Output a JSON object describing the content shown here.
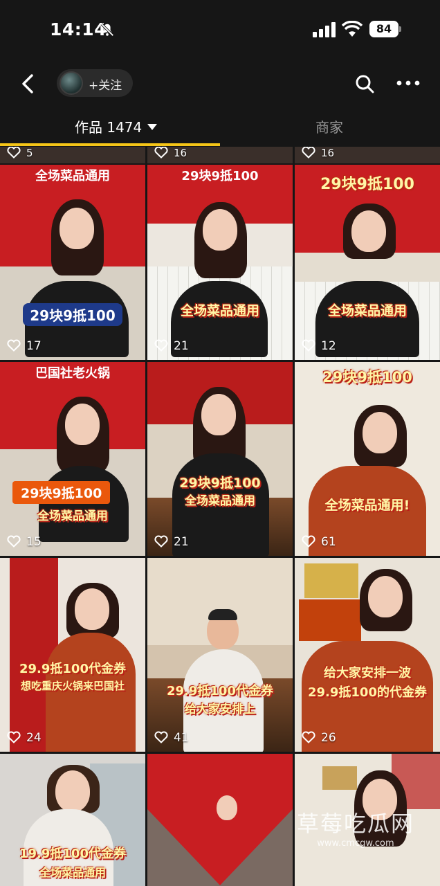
{
  "status_bar": {
    "time": "14:14",
    "battery": "84"
  },
  "nav": {
    "follow_label": "+关注"
  },
  "tabs": {
    "works_label": "作品 1474",
    "merchant_label": "商家"
  },
  "top_strip_likes": [
    "5",
    "16",
    "16"
  ],
  "tiles": [
    {
      "top_text": "全场菜品通用",
      "caption": "29块9抵100",
      "likes": "17"
    },
    {
      "top_text": "29块9抵100",
      "caption": "全场菜品通用",
      "likes": "21"
    },
    {
      "top_text": "29块9抵100",
      "caption": "全场菜品通用",
      "likes": "12"
    },
    {
      "top_text": "巴国社老火锅",
      "caption_1": "29块9抵100",
      "caption_2": "全场菜品通用",
      "likes": "15"
    },
    {
      "caption_1": "29块9抵100",
      "caption_2": "全场菜品通用",
      "likes": "21"
    },
    {
      "top_text": "29块9抵100",
      "caption": "全场菜品通用!",
      "likes": "61"
    },
    {
      "caption_1": "29.9抵100代金券",
      "caption_2": "想吃重庆火锅来巴国社",
      "likes": "24"
    },
    {
      "caption_1": "29.9抵100代金券",
      "caption_2": "给大家安排上",
      "likes": "41"
    },
    {
      "caption_1": "给大家安排一波",
      "caption_2": "29.9抵100的代金券",
      "likes": "26"
    },
    {
      "caption_1": "19.9抵100代金券",
      "caption_2": "全场菜品通用"
    },
    {},
    {}
  ],
  "watermark": {
    "title": "草莓吃瓜网",
    "url": "www.cmcgw.com"
  },
  "colors": {
    "accent": "#f5c518",
    "background": "#161616",
    "brand_red": "#c81e22"
  }
}
